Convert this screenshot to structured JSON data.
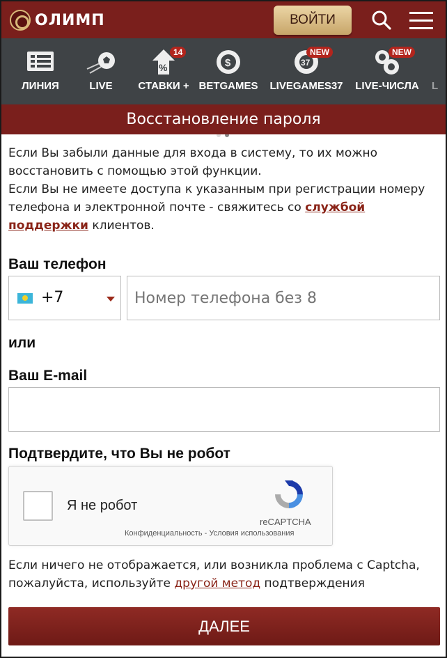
{
  "header": {
    "logo_text": "ОЛИМП",
    "login_label": "ВОЙТИ"
  },
  "nav": {
    "items": [
      {
        "label": "ЛИНИЯ",
        "icon": "line-list-icon"
      },
      {
        "label": "LIVE",
        "icon": "soccer-ball-icon"
      },
      {
        "label": "СТАВКИ +",
        "icon": "percent-arrow-icon",
        "badge": "14"
      },
      {
        "label": "BETGAMES",
        "icon": "chip-icon"
      },
      {
        "label": "LIVEGAMES37",
        "icon": "lottery-ball-icon",
        "badge": "NEW",
        "ball_number": "37"
      },
      {
        "label": "LIVE-ЧИСЛА",
        "icon": "chips-stack-icon",
        "badge": "NEW"
      },
      {
        "label": "L",
        "icon": "partial-icon"
      }
    ]
  },
  "page": {
    "title": "Восстановление пароля",
    "intro_line1": "Если Вы забыли данные для входа в систему, то их можно восстановить с помощью этой функции.",
    "intro_line2_prefix": "Если Вы не имеете доступа к указанным при регистрации номеру телефона и электронной почте - свяжитесь со ",
    "intro_link": "службой поддержки",
    "intro_line2_suffix": " клиентов."
  },
  "form": {
    "phone_label": "Ваш телефон",
    "country_code": "+7",
    "phone_placeholder": "Номер телефона без 8",
    "or_label": "или",
    "email_label": "Ваш E-mail",
    "email_value": "",
    "robot_label": "Подтвердите, что Вы не робот"
  },
  "captcha": {
    "checkbox_label": "Я не робот",
    "brand": "reCAPTCHA",
    "links": "Конфиденциальность - Условия использования"
  },
  "note": {
    "prefix": "Если ничего не отображается, или возникла проблема с Captcha, пожалуйста, используйте ",
    "link": "другой метод",
    "suffix": " подтверждения"
  },
  "next_label": "ДАЛЕЕ",
  "colors": {
    "brand": "#7a1f1c",
    "nav_bg": "#3f4346",
    "gold": "#d9b97a",
    "link": "#8a2418"
  }
}
